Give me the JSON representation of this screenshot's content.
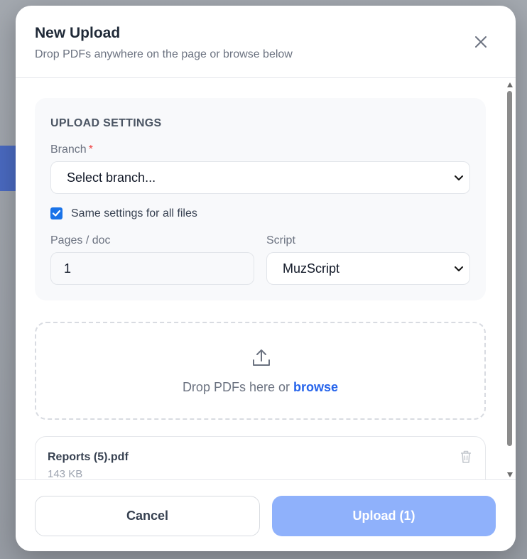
{
  "dialog": {
    "title": "New Upload",
    "subtitle": "Drop PDFs anywhere on the page or browse below",
    "close_icon": "close-icon"
  },
  "settings": {
    "heading": "UPLOAD SETTINGS",
    "branch_label": "Branch",
    "branch_required_mark": "*",
    "branch_value": "Select branch...",
    "same_settings_checked": true,
    "same_settings_label": "Same settings for all files",
    "pages_label": "Pages / doc",
    "pages_value": "1",
    "script_label": "Script",
    "script_value": "MuzScript"
  },
  "dropzone": {
    "icon": "upload-icon",
    "text": "Drop PDFs here or",
    "browse_label": "browse"
  },
  "files": [
    {
      "name": "Reports (5).pdf",
      "size": "143 KB",
      "remove_icon": "trash-icon"
    }
  ],
  "footer": {
    "cancel_label": "Cancel",
    "upload_label": "Upload (1)"
  },
  "colors": {
    "accent": "#2563eb",
    "checkbox": "#1a73e8",
    "upload_button": "#8fb1fb",
    "required": "#ef4444"
  }
}
